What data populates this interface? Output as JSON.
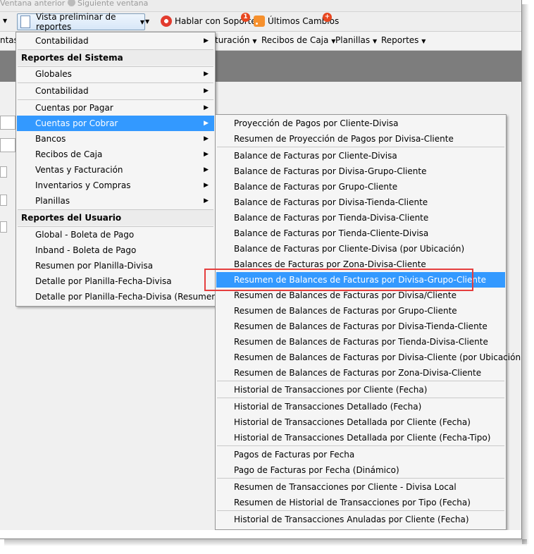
{
  "topbar": {
    "prev_window": "Ventana anterior",
    "next_window": "Siguiente ventana"
  },
  "toolbar": {
    "vista_preliminar": "Vista preliminar de reportes",
    "hablar_soporte": "Hablar con Soporte",
    "hablar_badge": "1",
    "ultimos_cambios": "Últimos Cambios",
    "ultimos_badge": "+"
  },
  "menubar": {
    "left_partial": "ntas",
    "items": [
      "turación",
      "Recibos de Caja",
      "Planillas",
      "Reportes"
    ]
  },
  "menu1": {
    "top_item": "Contabilidad",
    "header_sistema": "Reportes del Sistema",
    "sistema_items": [
      "Globales",
      "Contabilidad",
      "Cuentas por Pagar",
      "Cuentas por Cobrar",
      "Bancos",
      "Recibos de Caja",
      "Ventas y Facturación",
      "Inventarios y Compras",
      "Planillas"
    ],
    "header_usuario": "Reportes del Usuario",
    "usuario_items": [
      "Global - Boleta de Pago",
      "Inband - Boleta de Pago",
      "Resumen por Planilla-Divisa",
      "Detalle por Planilla-Fecha-Divisa",
      "Detalle por Planilla-Fecha-Divisa (Resumen)"
    ]
  },
  "menu2": {
    "group1": [
      "Proyección de Pagos por Cliente-Divisa",
      "Resumen de Proyección de Pagos por Divisa-Cliente"
    ],
    "group2": [
      "Balance de Facturas por Cliente-Divisa",
      "Balance de Facturas por Divisa-Grupo-Cliente",
      "Balance de Facturas por Grupo-Cliente",
      "Balance de Facturas por Divisa-Tienda-Cliente",
      "Balance de Facturas por Tienda-Divisa-Cliente",
      "Balance de Facturas por Tienda-Cliente-Divisa",
      "Balance de Facturas por Cliente-Divisa (por Ubicación)",
      "Balances de Facturas por Zona-Divisa-Cliente",
      "Resumen de Balances de Facturas por Divisa-Grupo-Cliente",
      "Resumen de Balances de Facturas por Divisa/Cliente",
      "Resumen de Balances de Facturas por Grupo-Cliente",
      "Resumen de Balances de Facturas por Divisa-Tienda-Cliente",
      "Resumen de Balances de Facturas por Tienda-Divisa-Cliente",
      "Resumen de Balances de Facturas por Divisa-Cliente (por Ubicación)",
      "Resumen de Balances de Facturas por Zona-Divisa-Cliente"
    ],
    "group3": [
      "Historial de Transacciones por Cliente (Fecha)"
    ],
    "group4": [
      "Historial de Transacciones Detallado (Fecha)",
      "Historial de Transacciones Detallada por Cliente (Fecha)",
      "Historial de Transacciones Detallada por Cliente (Fecha-Tipo)"
    ],
    "group5": [
      "Pagos de Facturas por Fecha",
      "Pago de Facturas por Fecha (Dinámico)"
    ],
    "group6": [
      "Resumen de Transacciones por Cliente - Divisa Local",
      "Resumen de Historial de Transacciones por Tipo (Fecha)"
    ],
    "group7": [
      "Historial de Transacciones Anuladas por Cliente (Fecha)"
    ]
  },
  "colors": {
    "highlight": "#3399ff",
    "annotation": "#e53e3e",
    "band": "#7d7d7d"
  }
}
